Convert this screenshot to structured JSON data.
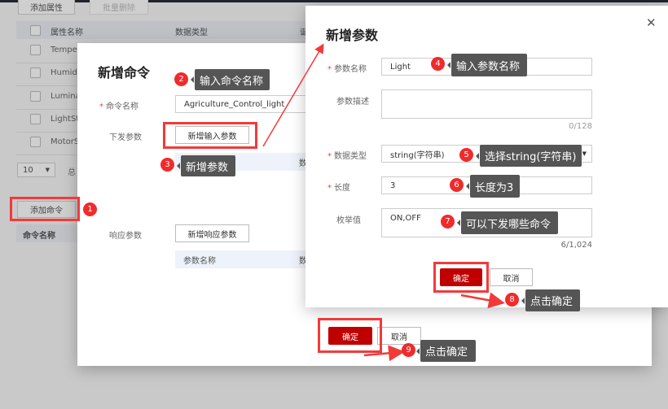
{
  "background": {
    "add_property": "添加属性",
    "batch_delete": "批量删除",
    "col_property_name": "属性名称",
    "col_data_type": "数据类型",
    "col_truncated": "诞",
    "rows": [
      "Temper",
      "Humidit",
      "Lumina",
      "LightSta",
      "MotorS"
    ],
    "page_size": "10",
    "total_truncated": "总",
    "add_command": "添加命令",
    "col_command_name": "命令名称"
  },
  "command_dialog": {
    "title": "新增命令",
    "name_label": "命令名称",
    "name_value": "Agriculture_Control_light",
    "send_params_label": "下发参数",
    "add_input_param": "新增输入参数",
    "col_param_name": "参数名称",
    "col_truncated": "数",
    "response_params_label": "响应参数",
    "add_response_param": "新增响应参数",
    "confirm": "确定",
    "cancel": "取消"
  },
  "param_dialog": {
    "title": "新增参数",
    "name_label": "参数名称",
    "name_value": "Light",
    "desc_label": "参数描述",
    "desc_value": "",
    "desc_counter": "0/128",
    "type_label": "数据类型",
    "type_value": "string(字符串)",
    "length_label": "长度",
    "length_value": "3",
    "enum_label": "枚举值",
    "enum_value": "ON,OFF",
    "enum_counter": "6/1,024",
    "confirm": "确定",
    "cancel": "取消",
    "close_icon": "close-icon"
  },
  "annotations": [
    {
      "n": "1",
      "text": ""
    },
    {
      "n": "2",
      "text": "输入命令名称"
    },
    {
      "n": "3",
      "text": "新增参数"
    },
    {
      "n": "4",
      "text": "输入参数名称"
    },
    {
      "n": "5",
      "text": "选择string(字符串)"
    },
    {
      "n": "6",
      "text": "长度为3"
    },
    {
      "n": "7",
      "text": "可以下发哪些命令"
    },
    {
      "n": "8",
      "text": "点击确定"
    },
    {
      "n": "9",
      "text": "点击确定"
    }
  ],
  "colors": {
    "primary": "#c00000",
    "highlight": "#f23a3a",
    "tooltip": "#555555"
  }
}
